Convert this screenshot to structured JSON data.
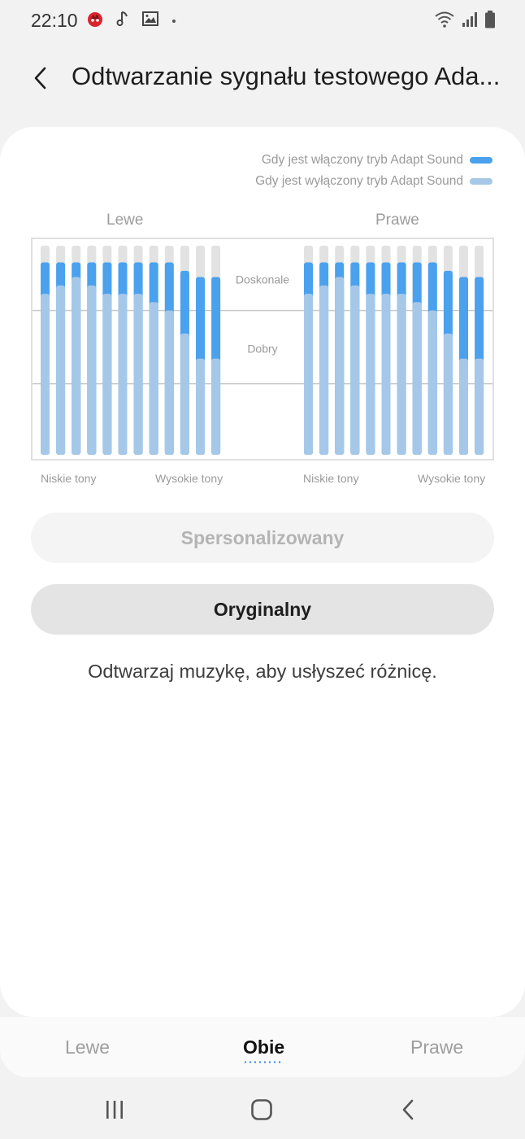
{
  "status_bar": {
    "time": "22:10",
    "left_icons": [
      "antutu-icon",
      "music-note-icon",
      "image-icon",
      "dot-icon"
    ],
    "right_icons": [
      "wifi-icon",
      "signal-icon",
      "battery-icon"
    ]
  },
  "header": {
    "back_icon": "chevron-left-icon",
    "title": "Odtwarzanie sygnału testowego Ada..."
  },
  "legend": {
    "on_label": "Gdy jest włączony tryb Adapt Sound",
    "off_label": "Gdy jest wyłączony tryb Adapt Sound"
  },
  "colors": {
    "on": "#4aa1ee",
    "off": "#a6c8e8",
    "track": "#e2e2e2"
  },
  "chart": {
    "left_label": "Lewe",
    "right_label": "Prawe",
    "band_excellent": "Doskonale",
    "band_good": "Dobry",
    "low_tones": "Niskie tony",
    "high_tones": "Wysokie tony"
  },
  "chart_data": {
    "type": "bar",
    "levels": {
      "max": 100,
      "excellent_threshold": 69,
      "good_threshold": 34
    },
    "series": [
      {
        "side": "Lewe",
        "adapt_on": [
          92,
          92,
          92,
          92,
          92,
          92,
          92,
          92,
          92,
          88,
          85,
          85
        ],
        "adapt_off": [
          77,
          81,
          85,
          81,
          77,
          77,
          77,
          73,
          69,
          58,
          46,
          46
        ]
      },
      {
        "side": "Prawe",
        "adapt_on": [
          92,
          92,
          92,
          92,
          92,
          92,
          92,
          92,
          92,
          88,
          85,
          85
        ],
        "adapt_off": [
          77,
          81,
          85,
          81,
          77,
          77,
          77,
          73,
          69,
          58,
          46,
          46
        ]
      }
    ]
  },
  "buttons": {
    "personalized": "Spersonalizowany",
    "original": "Oryginalny"
  },
  "hint": "Odtwarzaj muzykę, aby usłyszeć różnicę.",
  "tabs": {
    "left": "Lewe",
    "both": "Obie",
    "right": "Prawe",
    "selected": "both"
  },
  "navbar": {
    "recents_icon": "recents-icon",
    "home_icon": "home-icon",
    "back_icon": "back-icon"
  }
}
